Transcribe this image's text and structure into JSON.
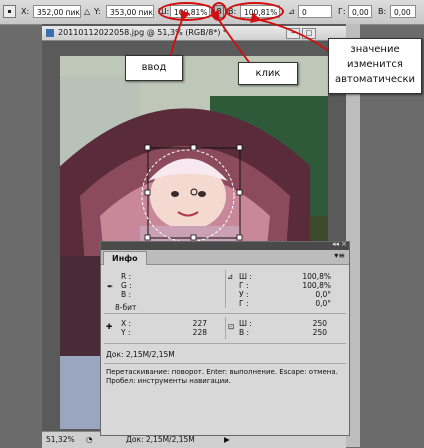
{
  "options_bar": {
    "x_label": "X:",
    "x_value": "352,00 пикс",
    "y_label": "Y:",
    "y_value": "353,00 пикс",
    "w_label": "Ш:",
    "w_value": "100,81%",
    "h_label": "В:",
    "h_value": "100,81%",
    "angle_value": "0",
    "hskew_label": "Г:",
    "hskew_value": "0,00",
    "vskew_label": "В:",
    "vskew_value": "0,00"
  },
  "document": {
    "title": "20110112022058.jpg @ 51,3% (RGB/8*) *",
    "zoom": "51,32%",
    "doc_size": "Док: 2,15M/2,15M"
  },
  "info_panel": {
    "tab": "Инфо",
    "r_label": "R :",
    "g_label": "G :",
    "b_label": "B :",
    "bit_label": "8-бит",
    "w_label": "Ш :",
    "w_value": "100,8%",
    "h_label": "Г :",
    "h_value": "100,8%",
    "angle_label": "У :",
    "angle_value": "0,0°",
    "skew_label": "Г :",
    "skew_value": "0,0°",
    "x_label": "X :",
    "x_value": "227",
    "y_label": "Y :",
    "y_value": "228",
    "sw_label": "Ш :",
    "sw_value": "250",
    "sh_label": "В :",
    "sh_value": "250",
    "doc_size": "Док: 2,15M/2,15M",
    "hint_line1": "Перетаскивание: поворот. Enter: выполнение. Escape: отмена.",
    "hint_line2": "Пробел: инструменты навигации."
  },
  "callouts": {
    "input": "ввод",
    "click": "клик",
    "note_line1": "значение",
    "note_line2": "изменится",
    "note_line3": "автоматически"
  },
  "colors": {
    "annotation": "#d01010",
    "panel_bg": "#d8d8d8",
    "workspace": "#6b6b6b"
  }
}
